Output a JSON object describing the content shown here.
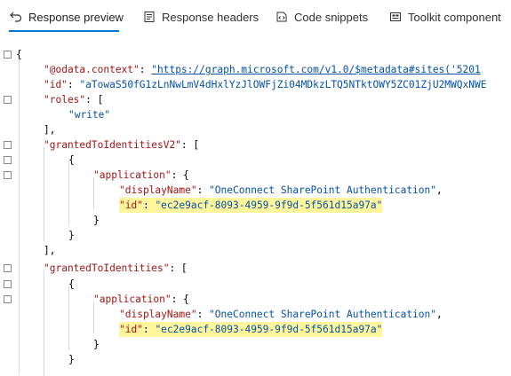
{
  "tabs": [
    {
      "label": "Response preview",
      "icon": "undo-arrow-icon",
      "active": true
    },
    {
      "label": "Response headers",
      "icon": "document-icon",
      "active": false
    },
    {
      "label": "Code snippets",
      "icon": "code-icon",
      "active": false
    },
    {
      "label": "Toolkit component",
      "icon": "component-icon",
      "active": false
    }
  ],
  "json_view": {
    "odata_context_key": "\"@odata.context\"",
    "odata_context_value": "\"https://graph.microsoft.com/v1.0/$metadata#sites('5201",
    "id_key": "\"id\"",
    "id_value": "\"aTowaS50fG1zLnNwLmV4dHxlYzJlOWFjZi04MDkzLTQ5NTktOWY5ZC01ZjU2MWQxNWE",
    "roles_key": "\"roles\"",
    "roles_value": "\"write\"",
    "granted_v2_key": "\"grantedToIdentitiesV2\"",
    "granted_key": "\"grantedToIdentities\"",
    "application_key": "\"application\"",
    "display_name_key": "\"displayName\"",
    "display_name_value": "\"OneConnect SharePoint Authentication\"",
    "app_id_key": "\"id\"",
    "app_id_value": "\"ec2e9acf-8093-4959-9f9d-5f561d15a97a\""
  }
}
